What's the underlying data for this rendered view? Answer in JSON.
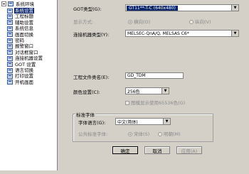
{
  "tree": {
    "root_label": "系统环境",
    "items": [
      {
        "label": "系统设置",
        "selected": true
      },
      {
        "label": "工程标题"
      },
      {
        "label": "辅助设置"
      },
      {
        "label": "系统信息"
      },
      {
        "label": "画面切换"
      },
      {
        "label": "密码"
      },
      {
        "label": "报警窗口"
      },
      {
        "label": "对话框窗口"
      },
      {
        "label": "连接机器设置"
      },
      {
        "label": "GOT 设置"
      },
      {
        "label": "语言切换"
      },
      {
        "label": "打印设置"
      },
      {
        "label": "开机画面"
      }
    ]
  },
  "form": {
    "got_type_label": "GOT类型(G):",
    "got_type_value": "GT11**-T-C (640x480)",
    "display_label": "显示方式:",
    "display_opt1": "横向(O)",
    "display_opt2": "纵向(V)",
    "controller_label": "连接机器类型(Y):",
    "controller_value": "MELSEC-QnA/Q, MELSAS C6*",
    "project_name_label": "工程文件类名(E):",
    "project_name_value": "GD_TDM",
    "color_label": "颜色设置(C):",
    "color_value": "256色",
    "color_check_label": "图模显示使用65536色(G)",
    "std_font_group": "标准字体",
    "font_lang_label": "字体语言(G):",
    "font_lang_value": "中文(简体)",
    "std_font_label": "公共标准字体:",
    "font_opt1": "宋体(S)",
    "font_opt2": "明朝(M)"
  },
  "buttons": {
    "ok": "确定",
    "cancel": "取消",
    "apply": "应用(A)"
  }
}
